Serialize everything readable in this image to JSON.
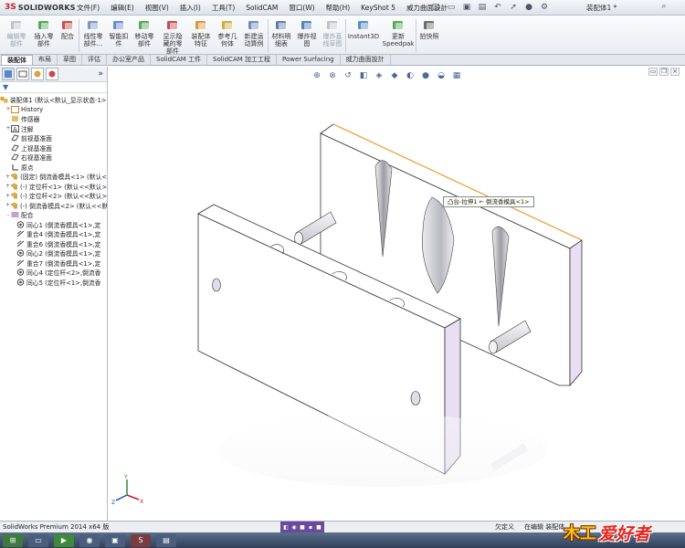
{
  "app": {
    "logo_ds": "3S",
    "logo_text": "SOLIDWORKS",
    "document_title": "装配体1 *",
    "menu": [
      "文件(F)",
      "编辑(E)",
      "视图(V)",
      "插入(I)",
      "工具(T)",
      "SolidCAM",
      "窗口(W)",
      "帮助(H)",
      "KeyShot 5",
      "威力曲面設計"
    ]
  },
  "ribbon": [
    {
      "label": "编辑零\n部件",
      "icon": "edit-component-icon",
      "disabled": true
    },
    {
      "label": "插入零\n部件",
      "icon": "insert-component-icon",
      "disabled": false
    },
    {
      "label": "配合",
      "icon": "mate-icon",
      "disabled": false
    },
    {
      "label": "线性零\n部件...",
      "icon": "linear-pattern-icon",
      "disabled": false
    },
    {
      "label": "智能扣\n件",
      "icon": "smart-fastener-icon",
      "disabled": false
    },
    {
      "label": "移动零\n部件",
      "icon": "move-component-icon",
      "disabled": false
    },
    {
      "label": "显示隐\n藏的零\n部件",
      "icon": "show-hidden-icon",
      "disabled": false
    },
    {
      "label": "装配体\n特征",
      "icon": "assembly-feature-icon",
      "disabled": false
    },
    {
      "label": "参考几\n何体",
      "icon": "reference-geometry-icon",
      "disabled": false
    },
    {
      "label": "新建运\n动算例",
      "icon": "new-motion-study-icon",
      "disabled": false
    },
    {
      "label": "材料明\n细表",
      "icon": "bom-icon",
      "disabled": false
    },
    {
      "label": "爆炸视\n图",
      "icon": "exploded-view-icon",
      "disabled": false
    },
    {
      "label": "爆炸直\n线草图",
      "icon": "explode-line-icon",
      "disabled": true
    },
    {
      "label": "Instant3D",
      "icon": "instant3d-icon",
      "disabled": false
    },
    {
      "label": "更新\nSpeedpak",
      "icon": "speedpak-icon",
      "disabled": false
    },
    {
      "label": "拍快照",
      "icon": "snapshot-icon",
      "disabled": false
    }
  ],
  "command_tabs": [
    "装配体",
    "布局",
    "草图",
    "评估",
    "办公室产品",
    "SolidCAM 工件",
    "SolidCAM 加工工程",
    "Power Surfacing",
    "威力曲面設計"
  ],
  "tree": [
    {
      "exp": "",
      "label": "装配体1  (默认<默认_显示状态-1>)",
      "icon": "assembly-icon",
      "indent": 0
    },
    {
      "exp": "+",
      "label": "History",
      "icon": "history-icon",
      "indent": 1
    },
    {
      "exp": "",
      "label": "传感器",
      "icon": "sensor-icon",
      "indent": 1
    },
    {
      "exp": "+",
      "label": "注解",
      "icon": "annotation-icon",
      "indent": 1
    },
    {
      "exp": "",
      "label": "前视基准面",
      "icon": "plane-icon",
      "indent": 1
    },
    {
      "exp": "",
      "label": "上视基准面",
      "icon": "plane-icon",
      "indent": 1
    },
    {
      "exp": "",
      "label": "右视基准面",
      "icon": "plane-icon",
      "indent": 1
    },
    {
      "exp": "",
      "label": "原点",
      "icon": "origin-icon",
      "indent": 1
    },
    {
      "exp": "+",
      "label": "(固定) 倒流香模具<1> (默认<",
      "icon": "part-icon",
      "indent": 1
    },
    {
      "exp": "+",
      "label": "(-) 定位杆<1> (默认<<默认>_",
      "icon": "part-icon",
      "indent": 1
    },
    {
      "exp": "+",
      "label": "(-) 定位杆<2> (默认<<默认>_",
      "icon": "part-icon",
      "indent": 1
    },
    {
      "exp": "+",
      "label": "(-) 倒流香模具<2> (默认<<默",
      "icon": "part-icon",
      "indent": 1
    },
    {
      "exp": "-",
      "label": "配合",
      "icon": "mates-folder-icon",
      "indent": 1
    },
    {
      "exp": "",
      "label": "同心1 (倒流香模具<1>,定",
      "icon": "concentric-icon",
      "indent": 2
    },
    {
      "exp": "",
      "label": "重合4 (倒流香模具<1>,定",
      "icon": "coincident-icon",
      "indent": 2
    },
    {
      "exp": "",
      "label": "重合6 (倒流香模具<1>,定",
      "icon": "coincident-icon",
      "indent": 2
    },
    {
      "exp": "",
      "label": "同心2 (倒流香模具<1>,定",
      "icon": "concentric-icon",
      "indent": 2
    },
    {
      "exp": "",
      "label": "重合7 (倒流香模具<1>,定",
      "icon": "coincident-icon",
      "indent": 2
    },
    {
      "exp": "",
      "label": "同心4 (定位杆<2>,倒流香",
      "icon": "concentric-icon",
      "indent": 2
    },
    {
      "exp": "",
      "label": "同心5 (定位杆<1>,倒流香",
      "icon": "concentric-icon",
      "indent": 2
    }
  ],
  "viewport": {
    "tooltip": "凸台-拉伸1 ← 倒流香模具<1>",
    "axes": {
      "x": "X",
      "y": "Y",
      "z": "Z"
    }
  },
  "status": {
    "left": "SolidWorks Premium 2014 x64 版",
    "right1": "欠定义",
    "right2": "在编辑 装配体"
  },
  "watermark": {
    "badge": "木工",
    "text": "爱好者"
  },
  "colors": {
    "accent": "#6a4a9c",
    "model_side": "#e8dff2",
    "edge_highlight": "#f0a030"
  }
}
